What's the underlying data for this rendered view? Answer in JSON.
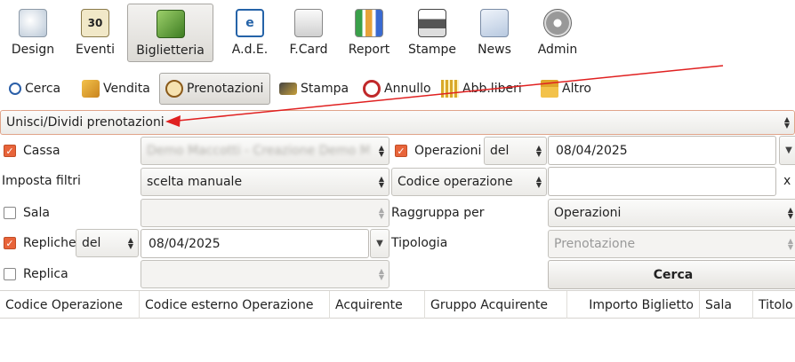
{
  "toolbar": {
    "items": [
      {
        "label": "Design",
        "icon": "design-icon"
      },
      {
        "label": "Eventi",
        "icon": "calendar-icon",
        "badge": "30"
      },
      {
        "label": "Biglietteria",
        "icon": "ticket-icon"
      },
      {
        "label": "A.d.E.",
        "icon": "ade-icon"
      },
      {
        "label": "F.Card",
        "icon": "card-icon"
      },
      {
        "label": "Report",
        "icon": "chart-icon"
      },
      {
        "label": "Stampe",
        "icon": "printer-icon"
      },
      {
        "label": "News",
        "icon": "mail-icon"
      },
      {
        "label": "Admin",
        "icon": "gears-icon"
      }
    ],
    "active": "Biglietteria"
  },
  "subtoolbar": {
    "items": [
      {
        "label": "Cerca",
        "icon": "search-icon"
      },
      {
        "label": "Vendita",
        "icon": "sale-icon"
      },
      {
        "label": "Prenotazioni",
        "icon": "clock-icon"
      },
      {
        "label": "Stampa",
        "icon": "print-icon"
      },
      {
        "label": "Annullo",
        "icon": "cancel-icon"
      },
      {
        "label": "Abb.liberi",
        "icon": "subscription-icon"
      },
      {
        "label": "Altro",
        "icon": "gift-icon"
      }
    ],
    "active": "Prenotazioni"
  },
  "mode_select": "Unisci/Dividi prenotazioni",
  "filters": {
    "cassa_label": "Cassa",
    "cassa_value": "Demo Maccotti - Creazione Demo Mac",
    "imposta_filtri_label": "Imposta filtri",
    "imposta_filtri_value": "scelta manuale",
    "sala_label": "Sala",
    "repliche_label": "Repliche",
    "repliche_mode": "del",
    "repliche_date": "08/04/2025",
    "replica_label": "Replica",
    "operazioni_label": "Operazioni",
    "operazioni_mode": "del",
    "operazioni_date": "08/04/2025",
    "codice_operazione": "Codice operazione",
    "clear_label": "x",
    "raggruppa_label": "Raggruppa per",
    "raggruppa_value": "Operazioni",
    "tipologia_label": "Tipologia",
    "tipologia_value": "Prenotazione",
    "cerca_button": "Cerca"
  },
  "table": {
    "columns": [
      "Codice Operazione",
      "Codice esterno Operazione",
      "Acquirente",
      "Gruppo Acquirente",
      "Importo Biglietto",
      "Sala",
      "Titolo"
    ]
  },
  "colors": {
    "accent": "#e8643a",
    "annotation_arrow": "#e02020"
  }
}
